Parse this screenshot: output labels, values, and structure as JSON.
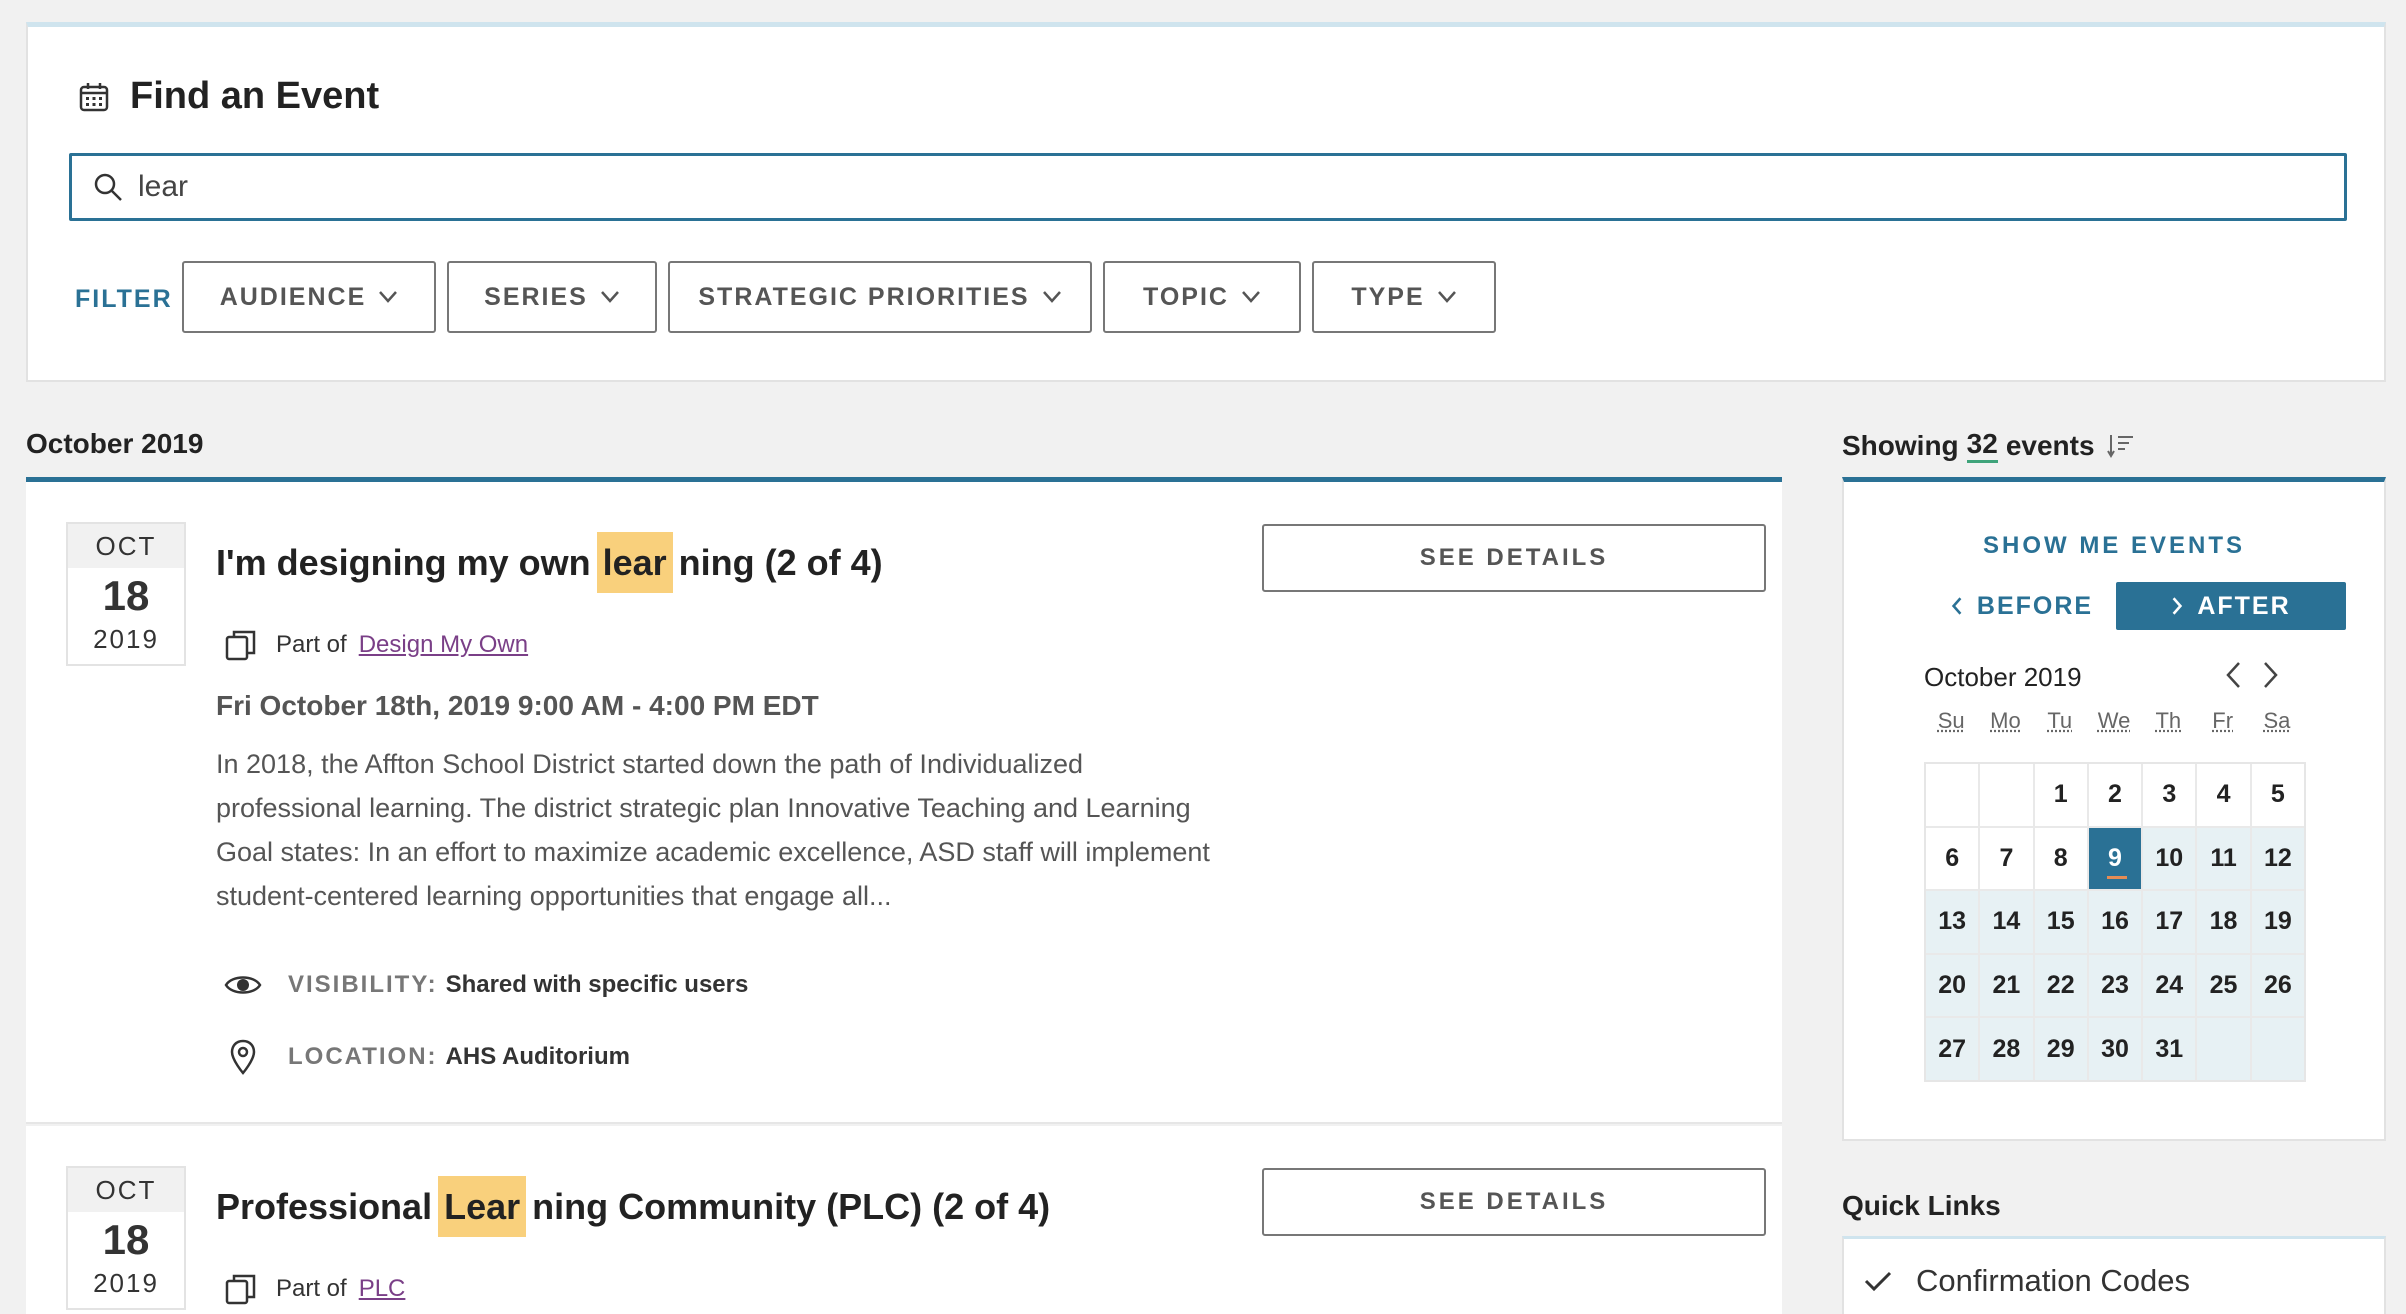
{
  "find": {
    "title": "Find an Event",
    "search_value": "lear",
    "filter_label": "FILTER",
    "filters": [
      "AUDIENCE",
      "SERIES",
      "STRATEGIC PRIORITIES",
      "TOPIC",
      "TYPE"
    ]
  },
  "list": {
    "month_header": "October 2019",
    "events": [
      {
        "mon": "OCT",
        "day": "18",
        "year": "2019",
        "title_pre": "I'm designing my own",
        "title_hl": "lear",
        "title_post": "ning (2 of 4)",
        "see_details": "SEE DETAILS",
        "part_of_label": "Part of",
        "part_of_link": "Design My Own",
        "time": "Fri October 18th, 2019 9:00 AM - 4:00 PM EDT",
        "description": "In 2018, the Affton School District started down the path of Individualized professional learning. The district strategic plan Innovative Teaching and Learning Goal states: In an effort to maximize academic excellence, ASD staff will implement student-centered learning opportunities that engage all...",
        "visibility_label": "VISIBILITY:",
        "visibility_value": "Shared with specific users",
        "location_label": "LOCATION:",
        "location_value": "AHS Auditorium"
      },
      {
        "mon": "OCT",
        "day": "18",
        "year": "2019",
        "title_pre": "Professional",
        "title_hl": "Lear",
        "title_post": "ning Community (PLC) (2 of 4)",
        "see_details": "SEE DETAILS",
        "part_of_label": "Part of",
        "part_of_link": "PLC"
      }
    ]
  },
  "sidebar": {
    "showing_pre": "Showing",
    "showing_count": "32",
    "showing_post": "events",
    "show_me": "SHOW ME EVENTS",
    "before": "BEFORE",
    "after": "AFTER",
    "calendar": {
      "month": "October 2019",
      "dow": [
        "Su",
        "Mo",
        "Tu",
        "We",
        "Th",
        "Fr",
        "Sa"
      ],
      "days": [
        "",
        "",
        "1",
        "2",
        "3",
        "4",
        "5",
        "6",
        "7",
        "8",
        "9",
        "10",
        "11",
        "12",
        "13",
        "14",
        "15",
        "16",
        "17",
        "18",
        "19",
        "20",
        "21",
        "22",
        "23",
        "24",
        "25",
        "26",
        "27",
        "28",
        "29",
        "30",
        "31",
        "",
        ""
      ],
      "today": "9"
    },
    "quick_links_title": "Quick Links",
    "quick_links": [
      "Confirmation Codes"
    ]
  },
  "colors": {
    "accent": "#2a7195",
    "highlight": "#f9d07c",
    "link": "#7a3f87"
  }
}
